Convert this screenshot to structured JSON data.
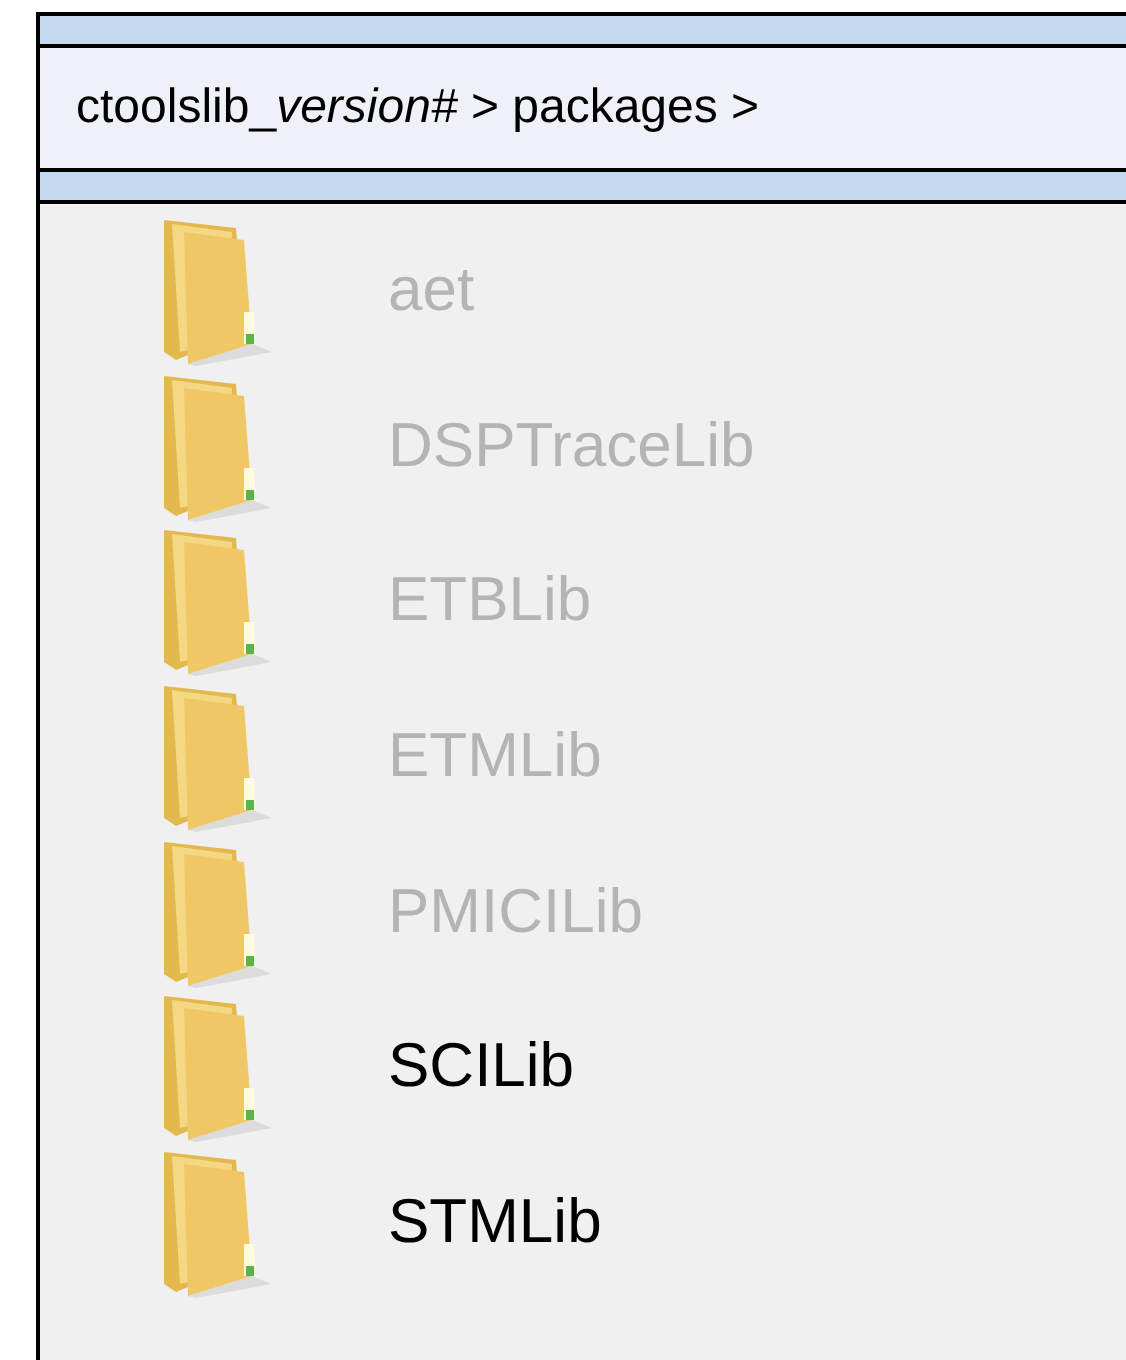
{
  "breadcrumb": [
    {
      "text": "ctoolslib_",
      "italic": false
    },
    {
      "text": "version#",
      "italic": true
    },
    {
      "text": " > packages >",
      "italic": false
    }
  ],
  "folders": [
    {
      "name": "aet",
      "disabled": true
    },
    {
      "name": "DSPTraceLib",
      "disabled": true
    },
    {
      "name": "ETBLib",
      "disabled": true
    },
    {
      "name": "ETMLib",
      "disabled": true
    },
    {
      "name": "PMICILib",
      "disabled": true
    },
    {
      "name": "SCILib",
      "disabled": false
    },
    {
      "name": "STMLib",
      "disabled": false
    }
  ]
}
